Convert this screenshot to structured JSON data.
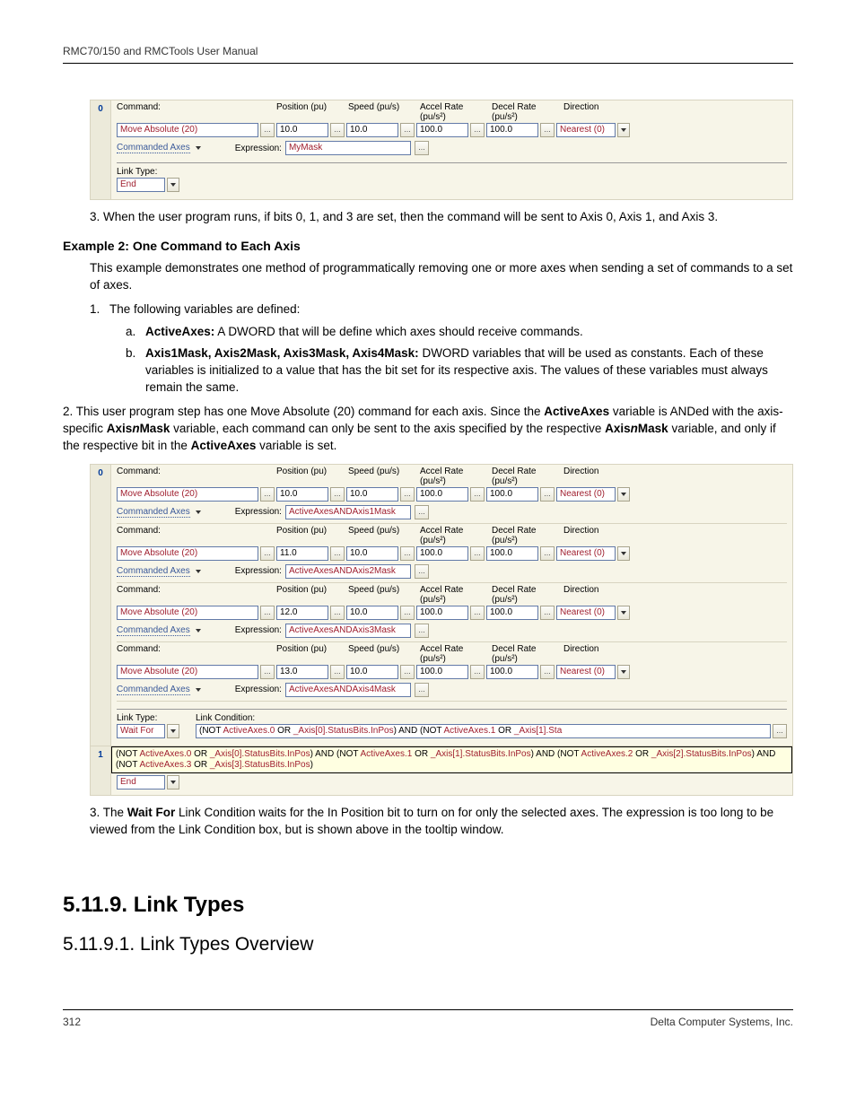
{
  "header": "RMC70/150 and RMCTools User Manual",
  "footer": {
    "page": "312",
    "company": "Delta Computer Systems, Inc."
  },
  "gui1": {
    "step": "0",
    "labels": {
      "command": "Command:",
      "position": "Position (pu)",
      "speed": "Speed (pu/s)",
      "accel": "Accel Rate (pu/s²)",
      "decel": "Decel Rate (pu/s²)",
      "direction": "Direction"
    },
    "command": "Move Absolute (20)",
    "position": "10.0",
    "speed": "10.0",
    "accel": "100.0",
    "decel": "100.0",
    "direction": "Nearest (0)",
    "commanded_axes": "Commanded Axes",
    "expression_label": "Expression:",
    "expression": "MyMask",
    "link_type_label": "Link Type:",
    "link_type": "End",
    "ellipsis": "..."
  },
  "para3": "3. When the user program runs, if bits 0, 1, and 3 are set, then the command will be sent to Axis 0, Axis 1, and Axis 3.",
  "ex2_title": "Example 2: One Command to Each Axis",
  "ex2_intro": "This example demonstrates one method of programmatically removing one or more axes when sending a set of commands to a set of axes.",
  "ex2_1": "The following variables are defined:",
  "ex2_1a_head": "ActiveAxes:",
  "ex2_1a_body": " A DWORD that will be define which axes should receive commands.",
  "ex2_1b_head": "Axis1Mask, Axis2Mask, Axis3Mask, Axis4Mask:",
  "ex2_1b_body": " DWORD variables that will be used as constants. Each of these variables is initialized to a value that has the bit set for its respective axis. The values of these variables must always remain the same.",
  "ex2_2a": "2.  This user program step has one Move Absolute (20) command for each axis. Since the ",
  "ex2_2b": "ActiveAxes",
  "ex2_2c": " variable is ANDed with the axis-specific ",
  "ex2_2d": "Axis",
  "ex2_2e": "n",
  "ex2_2f": "Mask",
  "ex2_2g": " variable, each command can only be sent to the axis specified by the respective ",
  "ex2_2h": " variable, and only if the respective bit in the ",
  "ex2_2i": " variable is set.",
  "gui2": {
    "step0": "0",
    "step1": "1",
    "labels": {
      "command": "Command:",
      "position": "Position (pu)",
      "speed": "Speed (pu/s)",
      "accel": "Accel Rate (pu/s²)",
      "decel": "Decel Rate (pu/s²)",
      "direction": "Direction"
    },
    "rows": [
      {
        "cmd": "Move Absolute (20)",
        "pos": "10.0",
        "spd": "10.0",
        "acc": "100.0",
        "dec": "100.0",
        "dir": "Nearest (0)",
        "expr_a": "ActiveAxes",
        "expr_b": " AND ",
        "expr_c": "Axis1Mask"
      },
      {
        "cmd": "Move Absolute (20)",
        "pos": "11.0",
        "spd": "10.0",
        "acc": "100.0",
        "dec": "100.0",
        "dir": "Nearest (0)",
        "expr_a": "ActiveAxes",
        "expr_b": " AND ",
        "expr_c": "Axis2Mask"
      },
      {
        "cmd": "Move Absolute (20)",
        "pos": "12.0",
        "spd": "10.0",
        "acc": "100.0",
        "dec": "100.0",
        "dir": "Nearest (0)",
        "expr_a": "ActiveAxes",
        "expr_b": " AND ",
        "expr_c": "Axis3Mask"
      },
      {
        "cmd": "Move Absolute (20)",
        "pos": "13.0",
        "spd": "10.0",
        "acc": "100.0",
        "dec": "100.0",
        "dir": "Nearest (0)",
        "expr_a": "ActiveAxes",
        "expr_b": " AND ",
        "expr_c": "Axis4Mask"
      }
    ],
    "commanded_axes": "Commanded Axes",
    "expression_label": "Expression:",
    "link_type_label": "Link Type:",
    "link_cond_label": "Link Condition:",
    "link_type": "Wait For",
    "link_cond": "(NOT ActiveAxes.0 OR _Axis[0].StatusBits.InPos) AND (NOT ActiveAxes.1 OR _Axis[1].Sta",
    "tooltip": "(NOT ActiveAxes.0 OR _Axis[0].StatusBits.InPos) AND (NOT ActiveAxes.1 OR _Axis[1].StatusBits.InPos) AND (NOT ActiveAxes.2 OR _Axis[2].StatusBits.InPos) AND (NOT ActiveAxes.3 OR _Axis[3].StatusBits.InPos)",
    "end": "End",
    "ellipsis": "..."
  },
  "ex2_3a": "3.  The ",
  "ex2_3b": "Wait For",
  "ex2_3c": " Link Condition waits for the In Position bit to turn on for only the selected axes. The expression is too long to be viewed from the Link Condition box, but is shown above in the tooltip window.",
  "h2": "5.11.9. Link Types",
  "h3": "5.11.9.1. Link Types Overview"
}
